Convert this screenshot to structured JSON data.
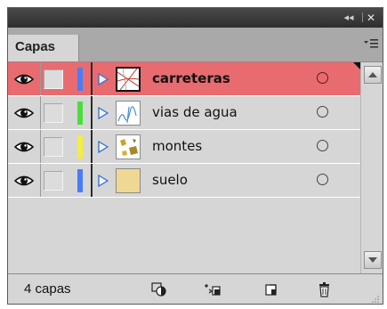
{
  "panel": {
    "tab_label": "Capas",
    "titlebar": {
      "collapse_glyph": "◂◂",
      "close_glyph": "✕"
    }
  },
  "layers": [
    {
      "name": "carreteras",
      "color": "#4a7cf6",
      "selected": true,
      "thumb_icon": "roads-thumbnail"
    },
    {
      "name": "vias de agua",
      "color": "#4ade3c",
      "selected": false,
      "thumb_icon": "waterways-thumbnail"
    },
    {
      "name": "montes",
      "color": "#f4ee3a",
      "selected": false,
      "thumb_icon": "hills-thumbnail"
    },
    {
      "name": "suelo",
      "color": "#4a7cf6",
      "selected": false,
      "thumb_icon": "soil-thumbnail"
    }
  ],
  "footer": {
    "count_label": "4 capas"
  },
  "colors": {
    "selected_row": "#e86b70",
    "panel_bg": "#d6d6d6",
    "tab_strip": "#a9a9a9",
    "titlebar": "#2e2e2e"
  }
}
